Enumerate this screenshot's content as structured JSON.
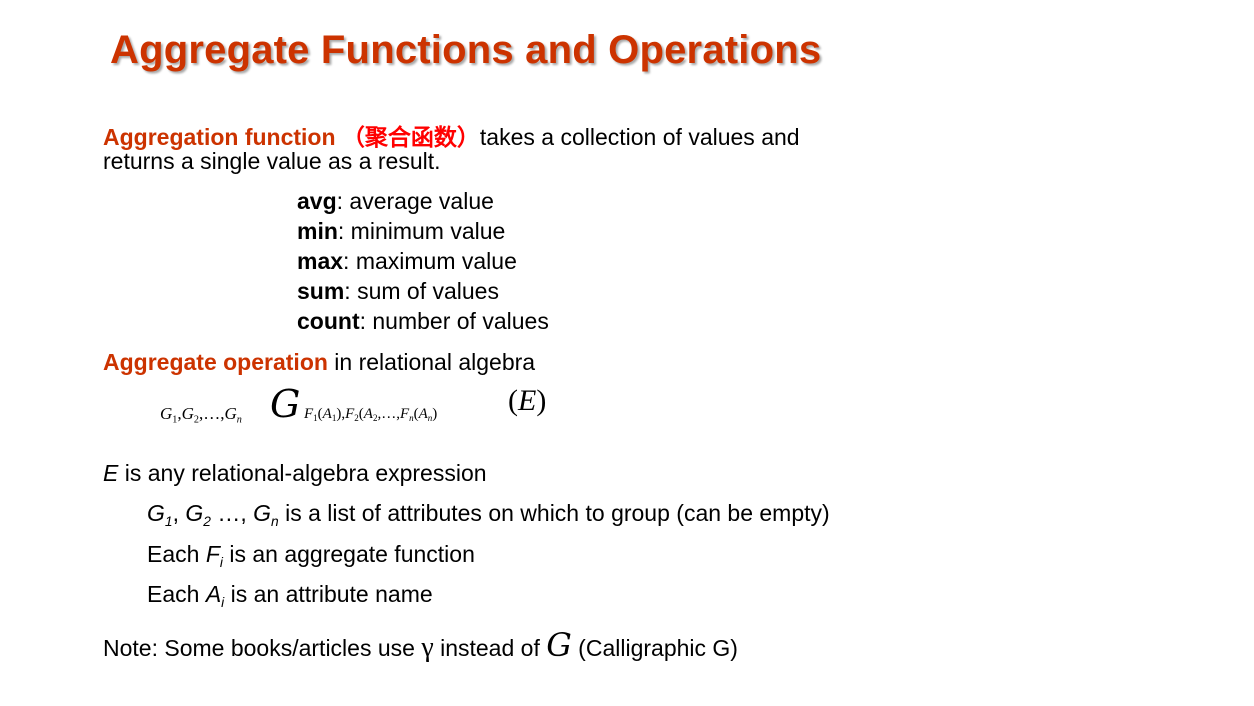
{
  "slide": {
    "title": "Aggregate Functions and Operations",
    "intro": {
      "term": "Aggregation function",
      "cjk": "（聚合函数）",
      "rest_line1": "takes a collection of values and",
      "line2": "returns a single value as a result."
    },
    "functions": [
      {
        "name": "avg",
        "desc": ":  average value"
      },
      {
        "name": "min",
        "desc": ":  minimum value"
      },
      {
        "name": "max",
        "desc": ":  maximum value"
      },
      {
        "name": "sum",
        "desc": ":  sum of values"
      },
      {
        "name": "count",
        "desc": ":  number of values"
      }
    ],
    "operation": {
      "term": "Aggregate operation",
      "rest": " in relational algebra"
    },
    "formula": {
      "groups": "G1,G2,…,Gn",
      "symbol": "G",
      "aggs": "F1(A1),F2(A2,…,Fn(An)",
      "expr": "(E)"
    },
    "explanations": {
      "e_var": "E",
      "e_text": " is any relational-algebra expression",
      "g_list": {
        "g1": "G",
        "sub1": "1",
        "sep1": ", ",
        "g2": "G",
        "sub2": "2",
        "sep2": " …, ",
        "gn": "G",
        "subn": "n",
        "text": " is a list of attributes on which to group (can be empty)"
      },
      "f_line": {
        "pre": "Each ",
        "var": "F",
        "sub": "i",
        "text": " is an aggregate function"
      },
      "a_line": {
        "pre": "Each ",
        "var": "A",
        "sub": "i",
        "text": " is an attribute name"
      }
    },
    "note": {
      "pre": "Note: Some books/articles use ",
      "gamma": "γ",
      "mid": " instead of ",
      "symbol": "G",
      "post": " (Calligraphic G)"
    }
  }
}
